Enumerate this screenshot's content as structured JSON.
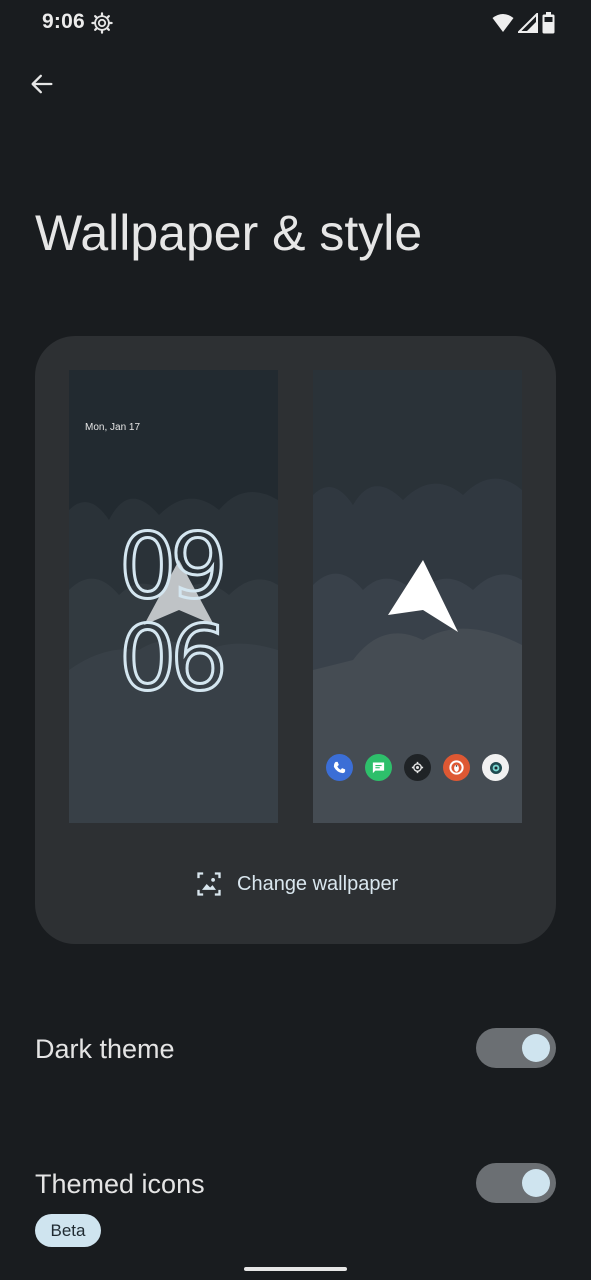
{
  "status_bar": {
    "time": "9:06"
  },
  "page": {
    "title": "Wallpaper & style"
  },
  "preview": {
    "lock_date": "Mon, Jan 17",
    "lock_hour": "09",
    "lock_minute": "06",
    "change_wallpaper_label": "Change wallpaper",
    "dock_apps": [
      "phone-icon",
      "messages-icon",
      "settings-icon",
      "duckduckgo-icon",
      "camera-icon"
    ]
  },
  "settings": {
    "dark_theme": {
      "label": "Dark theme",
      "enabled": true
    },
    "themed_icons": {
      "label": "Themed icons",
      "enabled": true,
      "badge": "Beta"
    }
  },
  "colors": {
    "background": "#191c1f",
    "card": "#2d3033",
    "accent": "#cfe4ef",
    "toggle_track": "#6b6f73"
  }
}
